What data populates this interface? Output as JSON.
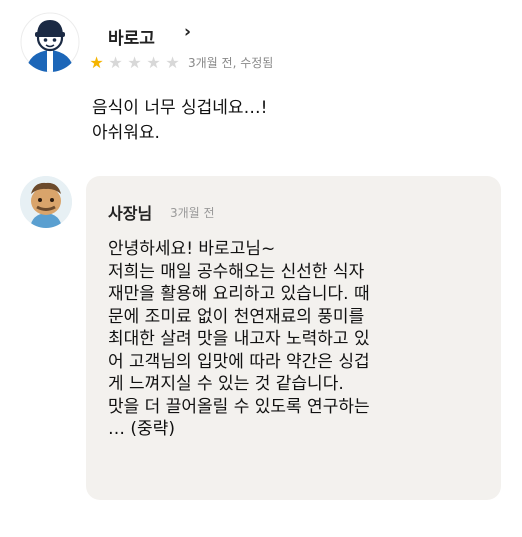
{
  "review": {
    "username": "바로고",
    "chevron": "›",
    "rating": 1,
    "max_rating": 5,
    "meta": "3개월 전, 수정됨",
    "text": "음식이 너무 싱겁네요…!\n아쉬워요."
  },
  "reply": {
    "owner_label": "사장님",
    "meta": "3개월 전",
    "text": "안녕하세요! 바로고님~\n저희는 매일 공수해오는 신선한 식자\n재만을 활용해 요리하고 있습니다. 때\n문에 조미료 없이 천연재료의 풍미를\n최대한 살려 맛을 내고자 노력하고 있\n어 고객님의 입맛에 따라 약간은 싱겁\n게 느껴지실 수 있는 것 같습니다.\n맛을 더 끌어올릴 수 있도록 연구하는\n… (중략)"
  },
  "colors": {
    "star_on": "#f5b400",
    "star_off": "#d8d8d8",
    "reply_bg": "#f3f1ee"
  },
  "icons": {
    "user_avatar": "delivery-rider-avatar-icon",
    "owner_avatar": "chef-character-avatar-icon",
    "chevron": "chevron-right-icon",
    "star": "star-icon"
  }
}
